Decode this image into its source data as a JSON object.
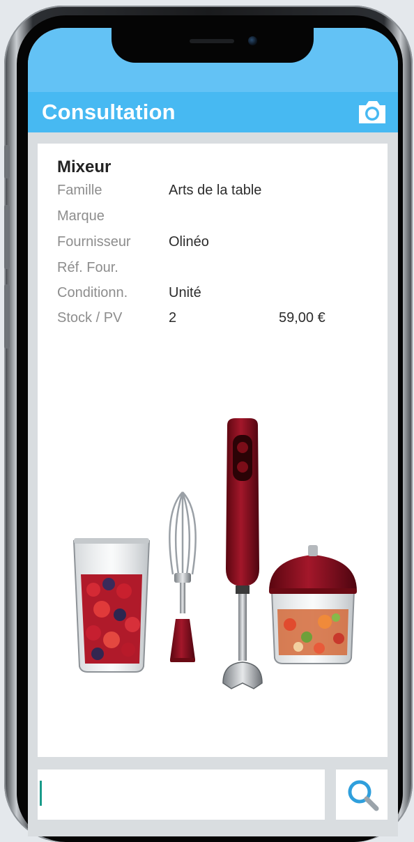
{
  "header": {
    "title": "Consultation",
    "camera_icon": "camera-icon"
  },
  "product": {
    "name": "Mixeur",
    "rows": [
      {
        "label": "Famille",
        "value": "Arts de la table"
      },
      {
        "label": "Marque",
        "value": ""
      },
      {
        "label": "Fournisseur",
        "value": "Olinéo"
      },
      {
        "label": "Réf. Four.",
        "value": ""
      },
      {
        "label": "Conditionn.",
        "value": "Unité"
      },
      {
        "label": "Stock / PV",
        "value": "2",
        "price": "59,00 €"
      }
    ],
    "image_icon": "hand-blender-product-image"
  },
  "search": {
    "value": "",
    "placeholder": "",
    "button_icon": "search-icon"
  },
  "colors": {
    "status_bar": "#63c2f5",
    "header": "#47b9f2",
    "accent": "#1a9b8a",
    "product_red": "#8c0f1c"
  }
}
